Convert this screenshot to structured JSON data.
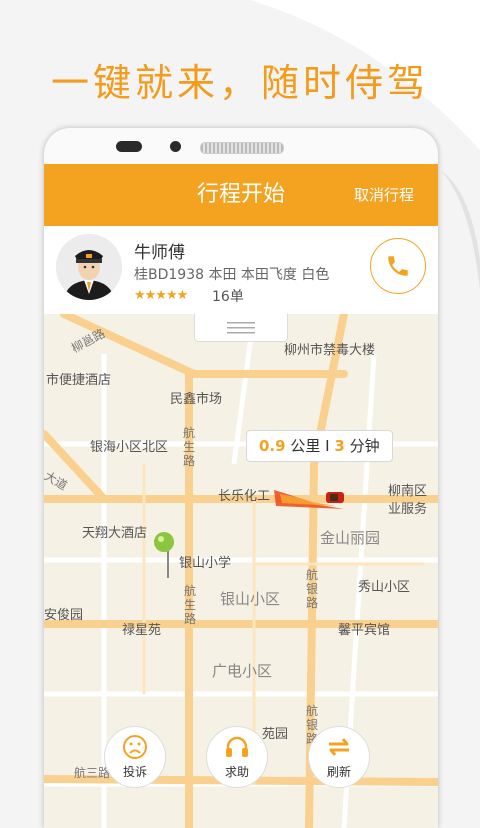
{
  "headline": "一键就来，随时侍驾",
  "topbar": {
    "title": "行程开始",
    "cancel": "取消行程"
  },
  "driver": {
    "name": "牛师傅",
    "car": "桂BD1938 本田 本田飞度 白色",
    "stars": "★★★★★",
    "orders": "16单"
  },
  "trip": {
    "distance": "0.9",
    "distance_unit": "公里",
    "sep": "I",
    "time": "3",
    "time_unit": "分钟"
  },
  "map": {
    "pois": {
      "p1": "柳州市禁毒大楼",
      "p2": "市便捷酒店",
      "p3": "民鑫市场",
      "p4": "银海小区北区",
      "p5": "长乐化工",
      "p6": "柳南区",
      "p7": "业服务",
      "p8": "天翔大酒店",
      "p9": "金山丽园",
      "p10": "银山小学",
      "p11": "秀山小区",
      "p12": "安俊园",
      "p13": "禄星苑",
      "p14": "银山小区",
      "p15": "馨平宾馆",
      "p16": "广电小区",
      "p17": "苑园"
    },
    "roads": {
      "r1": "柳邕路",
      "r2": "航生路",
      "r3": "航生路",
      "r4": "大道",
      "r5": "航银路",
      "r6": "航银路",
      "r7": "航三路"
    }
  },
  "actions": {
    "complain": "投诉",
    "help": "求助",
    "refresh": "刷新"
  },
  "colors": {
    "accent": "#f4a321",
    "headline": "#f39b1b"
  }
}
